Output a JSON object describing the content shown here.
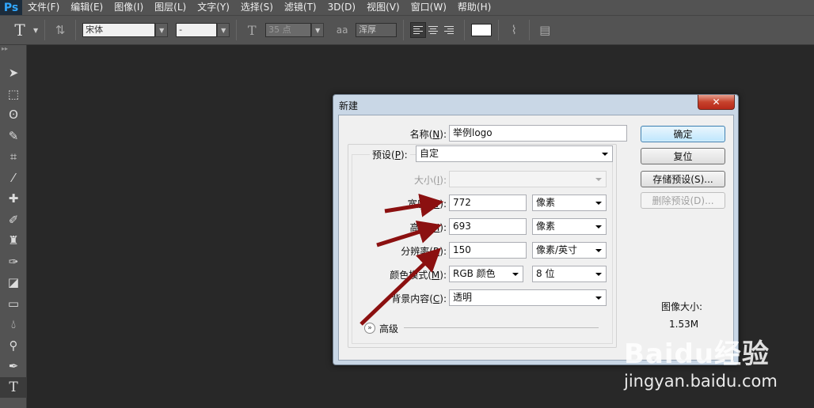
{
  "app": {
    "logo": "Ps"
  },
  "menu": [
    "文件(F)",
    "编辑(E)",
    "图像(I)",
    "图层(L)",
    "文字(Y)",
    "选择(S)",
    "滤镜(T)",
    "3D(D)",
    "视图(V)",
    "窗口(W)",
    "帮助(H)"
  ],
  "options": {
    "font_family": "宋体",
    "font_style": "-",
    "font_size": "35 点",
    "antialias_icon": "aa",
    "antialias": "浑厚"
  },
  "dialog": {
    "title": "新建",
    "close_label": "✕",
    "name_label": "名称(",
    "name_key": "N",
    "name_label_end": "):",
    "name_value": "举例logo",
    "preset_label": "预设(",
    "preset_key": "P",
    "preset_label_end": "):",
    "preset_value": "自定",
    "size_label": "大小(",
    "size_key": "I",
    "size_label_end": "):",
    "size_value": "",
    "width_label": "宽度(",
    "width_key": "W",
    "width_label_end": "):",
    "width_value": "772",
    "width_unit": "像素",
    "height_label": "高度(",
    "height_key": "H",
    "height_label_end": "):",
    "height_value": "693",
    "height_unit": "像素",
    "resolution_label": "分辨率(",
    "resolution_key": "R",
    "resolution_label_end": "):",
    "resolution_value": "150",
    "resolution_unit": "像素/英寸",
    "color_mode_label": "颜色模式(",
    "color_mode_key": "M",
    "color_mode_label_end": "):",
    "color_mode_value": "RGB 颜色",
    "bit_depth": "8 位",
    "background_label": "背景内容(",
    "background_key": "C",
    "background_label_end": "):",
    "background_value": "透明",
    "advanced_label": "高级",
    "ok_button": "确定",
    "reset_button": "复位",
    "save_preset_button": "存储预设(S)...",
    "delete_preset_button": "删除预设(D)...",
    "image_size_label": "图像大小:",
    "image_size_value": "1.53M"
  },
  "watermark": {
    "logo": "Baidu经验",
    "url": "jingyan.baidu.com"
  },
  "colors": {
    "arrow": "#8b1010",
    "panel": "#535353",
    "canvas": "#282828"
  }
}
